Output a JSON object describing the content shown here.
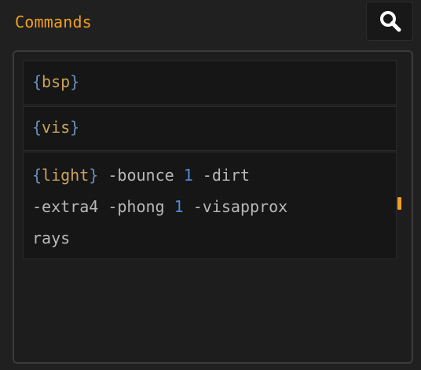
{
  "header": {
    "title": "Commands"
  },
  "search_button": {
    "icon": "search-icon"
  },
  "commands": [
    {
      "open": "{",
      "name": "bsp",
      "close": "}"
    },
    {
      "open": "{",
      "name": "vis",
      "close": "}"
    },
    {
      "open": "{",
      "name": "light",
      "close": "}",
      "args": {
        "bounce": "-bounce",
        "bounce_value": "1",
        "dirt": "-dirt",
        "extra": "-extra4",
        "phong": "-phong",
        "phong_value": "1",
        "visapprox": "-visapprox",
        "visapprox_value": "rays"
      }
    }
  ],
  "colors": {
    "accent": "#f0a020",
    "brace": "#6a8fb8",
    "keyword": "#c8a25e",
    "number": "#4f8ad0",
    "text": "#b8b8b8",
    "background": "#202020"
  }
}
